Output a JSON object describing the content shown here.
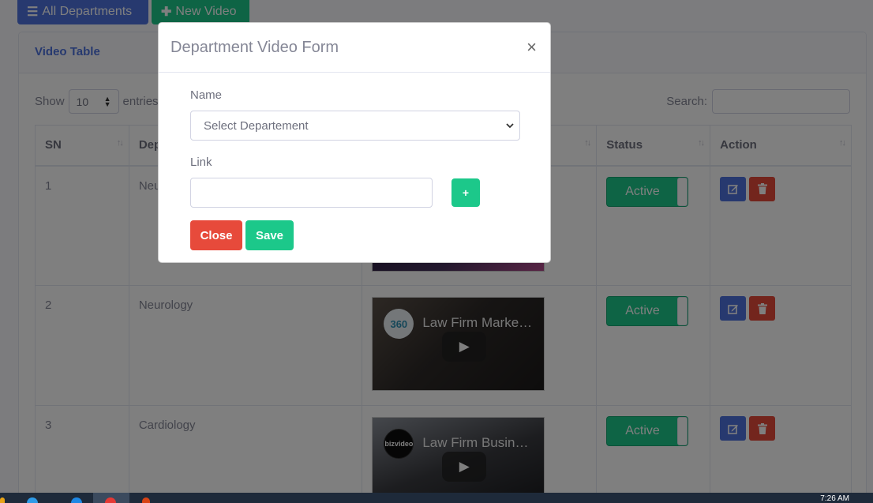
{
  "top_buttons": {
    "all_departments": "All Departments",
    "new_video": "New Video"
  },
  "card": {
    "title": "Video Table"
  },
  "datatable": {
    "show_label": "Show",
    "entries_value": "10",
    "entries_label": "entries",
    "search_label": "Search:"
  },
  "table": {
    "columns": [
      "SN",
      "Dep",
      "",
      "Status",
      "Action"
    ],
    "rows": [
      {
        "sn": "1",
        "department": "Neu",
        "video_title": "",
        "status": "Active"
      },
      {
        "sn": "2",
        "department": "Neurology",
        "video_title": "Law Firm Marke…",
        "video_logo": "360",
        "status": "Active"
      },
      {
        "sn": "3",
        "department": "Cardiology",
        "video_title": "Law Firm Busin…",
        "video_logo": "bizvideo",
        "status": "Active"
      }
    ]
  },
  "modal": {
    "title": "Department Video Form",
    "close_symbol": "×",
    "name_label": "Name",
    "name_select_value": "Select Departement",
    "link_label": "Link",
    "link_value": "",
    "add_link_symbol": "+",
    "close_button": "Close",
    "save_button": "Save"
  },
  "taskbar": {
    "time": "7:26 AM"
  },
  "colors": {
    "primary": "#4e73df",
    "success": "#1cc88a",
    "danger": "#e74a3b",
    "text_muted": "#858796",
    "overlay": "rgba(0,0,0,0.5)"
  },
  "icons": [
    "list-icon",
    "plus-icon",
    "sort-icon",
    "play-icon",
    "edit-icon",
    "trash-icon",
    "chevron-down-icon",
    "close-icon"
  ]
}
